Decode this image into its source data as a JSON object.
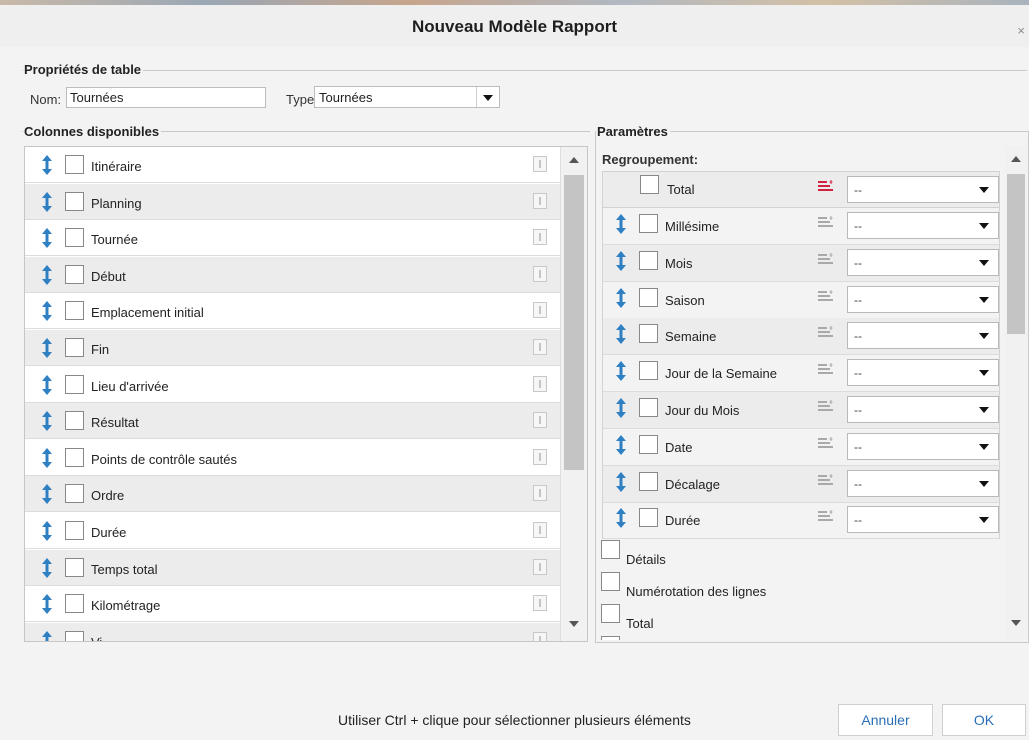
{
  "dialog": {
    "title": "Nouveau Modèle Rapport"
  },
  "table_props": {
    "legend": "Propriétés de table",
    "name_label": "Nom:",
    "name_value": "Tournées",
    "type_label": "Type:",
    "type_value": "Tournées"
  },
  "available_columns": {
    "legend": "Colonnes disponibles",
    "items": [
      {
        "label": "Itinéraire"
      },
      {
        "label": "Planning"
      },
      {
        "label": "Tournée"
      },
      {
        "label": "Début"
      },
      {
        "label": "Emplacement initial"
      },
      {
        "label": "Fin"
      },
      {
        "label": "Lieu d'arrivée"
      },
      {
        "label": "Résultat"
      },
      {
        "label": "Points de contrôle sautés"
      },
      {
        "label": "Ordre"
      },
      {
        "label": "Durée"
      },
      {
        "label": "Temps total"
      },
      {
        "label": "Kilométrage"
      },
      {
        "label": "Vi..."
      }
    ]
  },
  "parameters": {
    "legend": "Paramètres",
    "grouping_label": "Regroupement:",
    "total_row": {
      "label": "Total",
      "select_value": "--"
    },
    "grouping_items": [
      {
        "label": "Millésime",
        "select_value": "--"
      },
      {
        "label": "Mois",
        "select_value": "--"
      },
      {
        "label": "Saison",
        "select_value": "--"
      },
      {
        "label": "Semaine",
        "select_value": "--"
      },
      {
        "label": "Jour de la Semaine",
        "select_value": "--"
      },
      {
        "label": "Jour du Mois",
        "select_value": "--"
      },
      {
        "label": "Date",
        "select_value": "--"
      },
      {
        "label": "Décalage",
        "select_value": "--"
      },
      {
        "label": "Durée",
        "select_value": "--"
      }
    ],
    "options": [
      {
        "label": "Détails"
      },
      {
        "label": "Numérotation des lignes"
      },
      {
        "label": "Total"
      }
    ]
  },
  "footer": {
    "hint": "Utiliser Ctrl + clique pour sélectionner plusieurs éléments",
    "cancel_label": "Annuler",
    "ok_label": "OK"
  },
  "colors": {
    "drag_icon": "#2f7fc3",
    "accent_sort": "#d1233f",
    "button_text": "#2a6eb8"
  },
  "icons": {
    "drag": "vertical-arrows-icon",
    "info": "i-cursor-icon",
    "sort": "sort-lines-icon"
  }
}
